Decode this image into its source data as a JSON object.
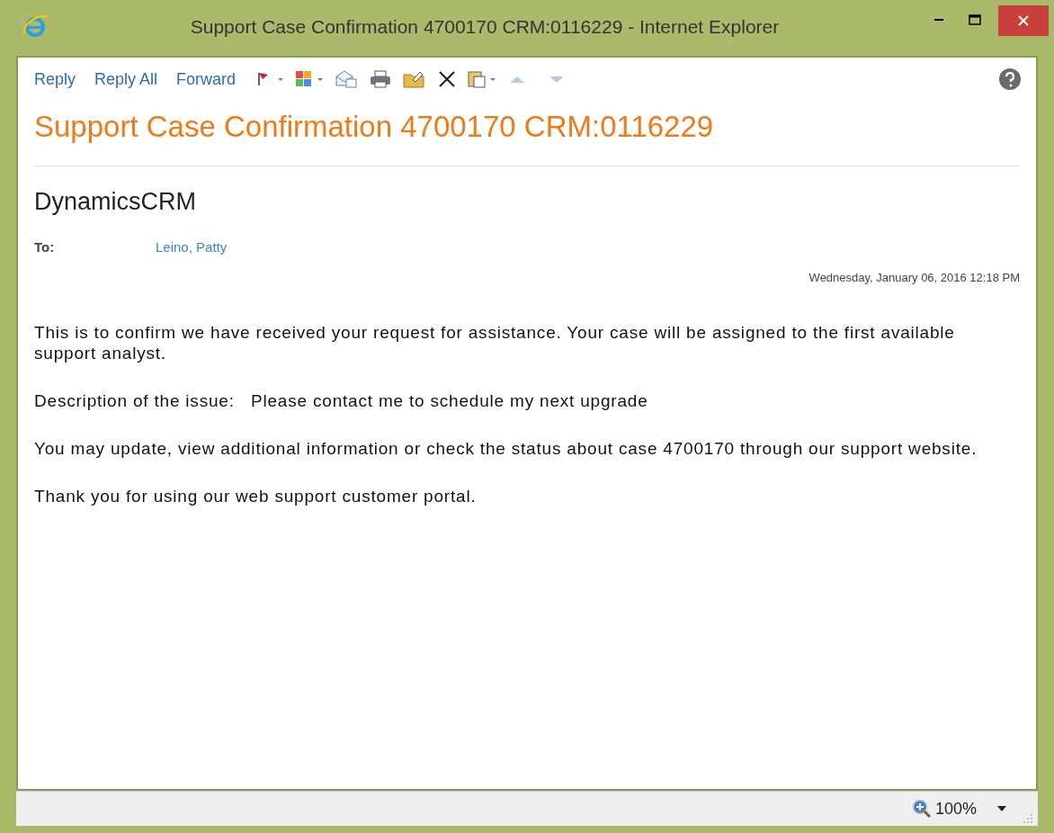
{
  "window": {
    "title": "Support Case Confirmation 4700170 CRM:0116229 - Internet Explorer"
  },
  "toolbar": {
    "links": [
      "Reply",
      "Reply All",
      "Forward"
    ],
    "nav_buttons": [
      {
        "disabled": true
      },
      {
        "disabled": true
      }
    ]
  },
  "message": {
    "subject": "Support Case Confirmation 4700170 CRM:0116229",
    "sender": "DynamicsCRM",
    "to_label": "To:",
    "to": "Leino, Patty",
    "date": "Wednesday, January 06, 2016 12:18 PM",
    "paragraphs": [
      "This is to confirm we have received your request for assistance. Your case will be assigned to the first available support analyst.",
      "Description of the issue:   Please contact me to schedule my next upgrade",
      "You may update, view additional information or check the status about case 4700170 through our support website.",
      "Thank you for using our web support customer portal."
    ]
  },
  "status_bar": {
    "zoom": "100%"
  }
}
